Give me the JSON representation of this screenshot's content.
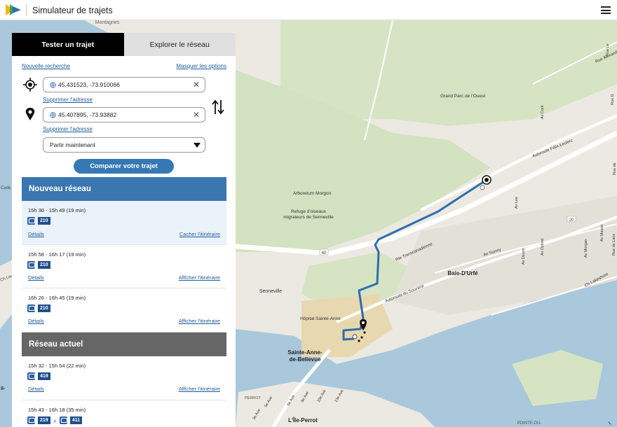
{
  "app": {
    "title": "Simulateur de trajets"
  },
  "tabs": [
    {
      "label": "Tester un trajet",
      "active": true
    },
    {
      "label": "Explorer le réseau",
      "active": false
    }
  ],
  "form": {
    "new_search": "Nouvelle recherche",
    "hide_options": "Masquer les options",
    "origin_value": "45.431523, -73.910066",
    "destination_value": "45.407895, -73.93882",
    "remove_address": "Supprimer l'adresse",
    "departure_option": "Partir maintenant",
    "compare_button": "Comparer votre trajet"
  },
  "new_network": {
    "title": "Nouveau réseau",
    "color": "#3a76b0",
    "results": [
      {
        "time": "15h 30 - 15h 49 (19 min)",
        "routes": [
          "210"
        ],
        "details": "Détails",
        "toggle": "Cacher l'itinéraire",
        "selected": true
      },
      {
        "time": "15h 58 - 16h 17 (19 min)",
        "routes": [
          "210"
        ],
        "details": "Détails",
        "toggle": "Afficher l'itinéraire",
        "selected": false
      },
      {
        "time": "16h 26 - 16h 45 (19 min)",
        "routes": [
          "210"
        ],
        "details": "Détails",
        "toggle": "Afficher l'itinéraire",
        "selected": false
      }
    ]
  },
  "current_network": {
    "title": "Réseau actuel",
    "color": "#666666",
    "results": [
      {
        "time": "15h 32 - 15h 54 (22 min)",
        "routes": [
          "419"
        ],
        "details": "Détails",
        "toggle": "Afficher l'itinéraire"
      },
      {
        "time": "15h 43 - 16h 18 (35 min)",
        "routes": [
          "219",
          "411"
        ]
      }
    ]
  },
  "map": {
    "labels": {
      "grand_parc": "Grand Parc de l'Ouest",
      "arboretum": "Arboretum Morgon",
      "refuge_1": "Refuge d'oiseaux",
      "refuge_2": "migrateurs de Senneville",
      "senneville": "Senneville",
      "baie_durfe": "Baie-D'Urfé",
      "hopital": "Hôpital Sainte-Anne",
      "sainte_anne_1": "Sainte-Anne-",
      "sainte_anne_2": "de-Bellevue",
      "ile_perrot": "L'Île-Perrot",
      "pointe_du": "POINTE-DU-",
      "perrot": "PERROT",
      "montagnes": "Montagnes",
      "felix_leclerc": "Autoroute Félix-Leclerc",
      "transcanadienne": "Rte Transcanadienne",
      "souvenir": "Autoroute du Souvenir",
      "surrey": "Av Surrey",
      "lakeshore": "Ch Lakeshore",
      "rue_alexander": "Rue Alexander",
      "av_lee": "Av Lee",
      "av_oxford": "Av Oxford",
      "av_devon": "Av Devon",
      "av_morgan": "Av Morgan",
      "av_maxon": "Av Maxon",
      "av_cork": "Av Cork",
      "rue_lanc": "Rue de Lanc",
      "rue_le": "Rue Le",
      "rue_d": "Rue D",
      "rue_de": "Rue de",
      "ave_5e": "5e Ave",
      "ave_3e": "3e Ave",
      "ave_6e": "6e Ave",
      "ave_8e": "8e Ave",
      "ave_10e": "10e Ave",
      "ave_13e": "13e Ave",
      "cade": "Cade",
      "ch_leclerc": "Ch Lecler",
      "il": "il-",
      "rt20": "20",
      "rt40": "40",
      "colors": {
        "land": "#ece9e2",
        "park": "#d6e4c4",
        "water": "#a9c8dc",
        "road": "#ffffff",
        "route": "#2e6ead"
      }
    }
  }
}
